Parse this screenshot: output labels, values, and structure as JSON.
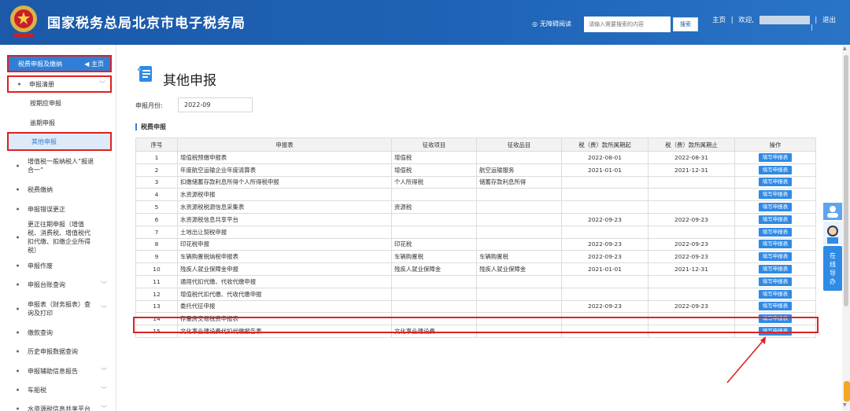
{
  "header": {
    "title": "国家税务总局北京市电子税务局",
    "accessibility": "无障碍阅读",
    "search_placeholder": "请输入需要搜索的内容",
    "search_button": "搜索",
    "home": "主页",
    "welcome": "欢迎,",
    "logout": "退出",
    "sep": "|"
  },
  "sidebar": {
    "head_label": "税费申报及缴纳",
    "head_home": "主页",
    "items": [
      {
        "label": "申报清册"
      },
      {
        "label": "按期应申报"
      },
      {
        "label": "逾期申报"
      },
      {
        "label": "其他申报"
      },
      {
        "label": "增值税一般纳税人“报退合一”"
      },
      {
        "label": "税费缴纳"
      },
      {
        "label": "申报错误更正"
      },
      {
        "label": "更正往期申报（增值税、消费税、增值税代扣代缴、扣缴企业所得税）"
      },
      {
        "label": "申报作废"
      },
      {
        "label": "申报台账查询"
      },
      {
        "label": "申报表（财务报表）查询及打印"
      },
      {
        "label": "缴款查询"
      },
      {
        "label": "历史申报数据查询"
      },
      {
        "label": "申报辅助信息报告"
      },
      {
        "label": "车船税"
      },
      {
        "label": "水资源税信息共享平台"
      }
    ]
  },
  "main": {
    "title": "其他申报",
    "month_label": "申报月份:",
    "month_value": "2022-09",
    "section_title": "税费申报",
    "columns": [
      "序号",
      "申报表",
      "征收项目",
      "征收品目",
      "税（费）款所属期起",
      "税（费）款所属期止",
      "操作"
    ],
    "action_label": "填写申报表",
    "rows": [
      {
        "no": "1",
        "form": "增值税预缴申报表",
        "item": "增值税",
        "sub": "",
        "start": "2022-08-01",
        "end": "2022-08-31"
      },
      {
        "no": "2",
        "form": "年度航空运输企业年度清算表",
        "item": "增值税",
        "sub": "航空运输服务",
        "start": "2021-01-01",
        "end": "2021-12-31"
      },
      {
        "no": "3",
        "form": "扣缴储蓄存款利息所得个人所得税申报",
        "item": "个人所得税",
        "sub": "储蓄存款利息所得",
        "start": "",
        "end": ""
      },
      {
        "no": "4",
        "form": "水资源税申报",
        "item": "",
        "sub": "",
        "start": "",
        "end": ""
      },
      {
        "no": "5",
        "form": "水资源税税源信息采集表",
        "item": "资源税",
        "sub": "",
        "start": "",
        "end": ""
      },
      {
        "no": "6",
        "form": "水资源税信息共享平台",
        "item": "",
        "sub": "",
        "start": "2022-09-23",
        "end": "2022-09-23"
      },
      {
        "no": "7",
        "form": "土地出让契税申报",
        "item": "",
        "sub": "",
        "start": "",
        "end": ""
      },
      {
        "no": "8",
        "form": "印花税申报",
        "item": "印花税",
        "sub": "",
        "start": "2022-09-23",
        "end": "2022-09-23"
      },
      {
        "no": "9",
        "form": "车辆购置税纳税申报表",
        "item": "车辆购置税",
        "sub": "车辆购置税",
        "start": "2022-09-23",
        "end": "2022-09-23"
      },
      {
        "no": "10",
        "form": "残疾人就业保障金申报",
        "item": "残疾人就业保障金",
        "sub": "残疾人就业保障金",
        "start": "2021-01-01",
        "end": "2021-12-31"
      },
      {
        "no": "11",
        "form": "通用代扣代缴、代收代缴申报",
        "item": "",
        "sub": "",
        "start": "",
        "end": ""
      },
      {
        "no": "12",
        "form": "增值税代扣代缴、代收代缴申报",
        "item": "",
        "sub": "",
        "start": "",
        "end": ""
      },
      {
        "no": "13",
        "form": "委托代征申报",
        "item": "",
        "sub": "",
        "start": "2022-09-23",
        "end": "2022-09-23"
      },
      {
        "no": "14",
        "form": "存量房交易税费申报表",
        "item": "",
        "sub": "",
        "start": "",
        "end": ""
      },
      {
        "no": "15",
        "form": "文化事业建设费代扣代缴报告表",
        "item": "文化事业建设费",
        "sub": "",
        "start": "",
        "end": ""
      }
    ]
  },
  "float": {
    "online_help": [
      "在",
      "线",
      "导",
      "办"
    ]
  },
  "colors": {
    "header_bg": "#1c59a8",
    "accent": "#2f8ae6",
    "highlight": "#e02020"
  }
}
